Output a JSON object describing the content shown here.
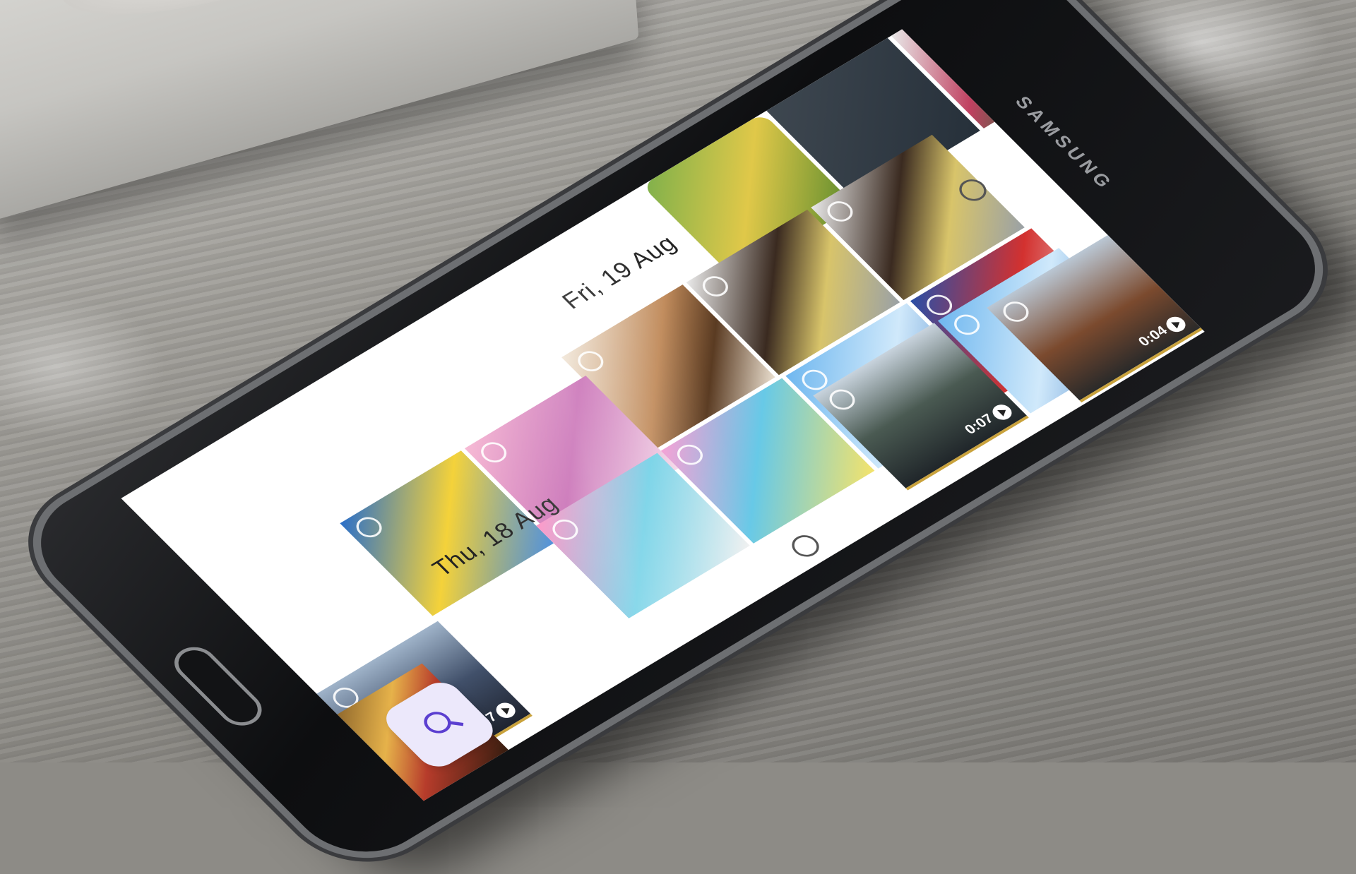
{
  "device": {
    "brand": "SAMSUNG"
  },
  "gallery": {
    "sections": [
      {
        "date": "Fri, 19 Aug"
      },
      {
        "date": "Thu, 18 Aug"
      }
    ],
    "videos": [
      {
        "duration": "0:07"
      },
      {
        "duration": "0:07"
      },
      {
        "duration": "0:04"
      }
    ],
    "search_button_icon": "search-icon"
  }
}
